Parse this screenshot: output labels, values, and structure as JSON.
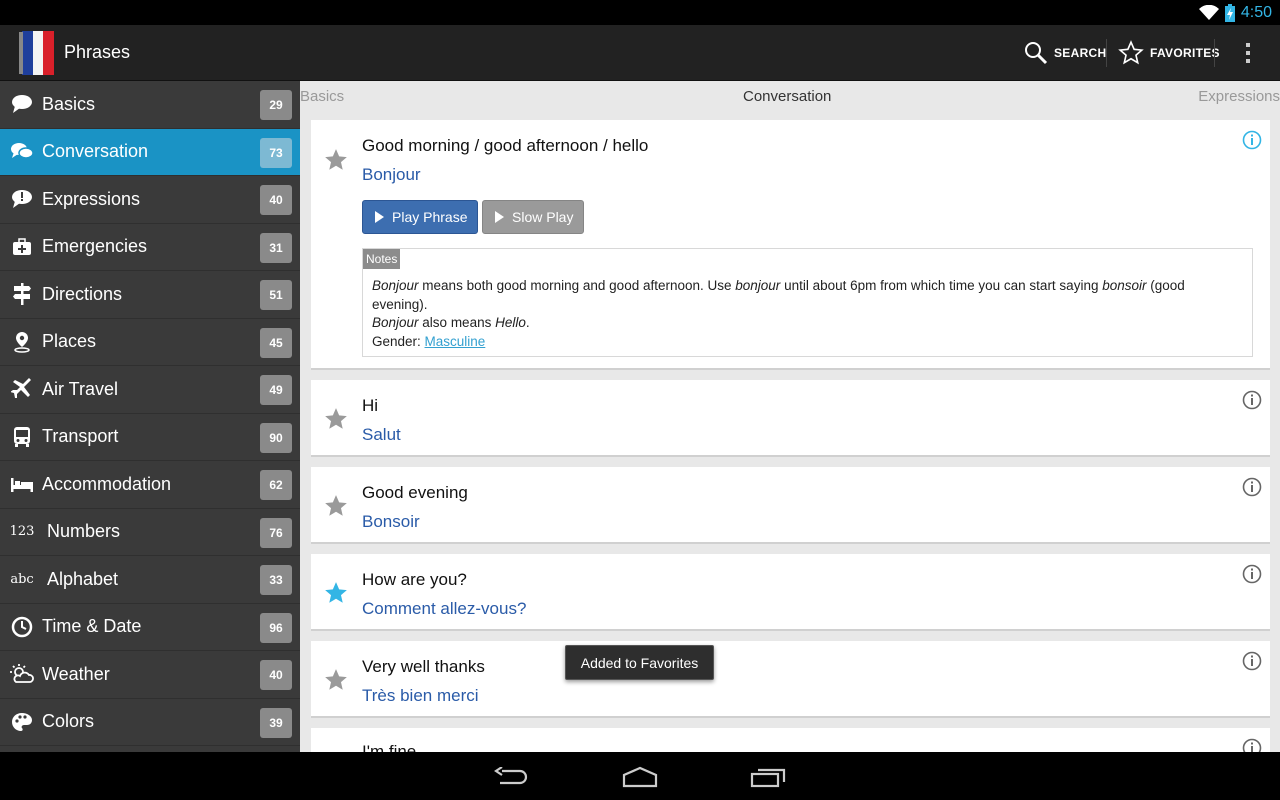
{
  "status_bar": {
    "time": "4:50"
  },
  "action_bar": {
    "title": "Phrases",
    "search_label": "SEARCH",
    "favorites_label": "FAVORITES"
  },
  "sidebar": {
    "items": [
      {
        "label": "Basics",
        "count": "29",
        "icon": "speech-bubble-icon"
      },
      {
        "label": "Conversation",
        "count": "73",
        "icon": "conversation-bubbles-icon",
        "active": true
      },
      {
        "label": "Expressions",
        "count": "40",
        "icon": "exclamation-bubble-icon"
      },
      {
        "label": "Emergencies",
        "count": "31",
        "icon": "first-aid-kit-icon"
      },
      {
        "label": "Directions",
        "count": "51",
        "icon": "signpost-icon"
      },
      {
        "label": "Places",
        "count": "45",
        "icon": "map-pin-icon"
      },
      {
        "label": "Air Travel",
        "count": "49",
        "icon": "airplane-icon"
      },
      {
        "label": "Transport",
        "count": "90",
        "icon": "bus-icon"
      },
      {
        "label": "Accommodation",
        "count": "62",
        "icon": "bed-icon"
      },
      {
        "label": "Numbers",
        "count": "76",
        "icon": "numbers-icon",
        "icon_text": "123"
      },
      {
        "label": "Alphabet",
        "count": "33",
        "icon": "alphabet-icon",
        "icon_text": "abc"
      },
      {
        "label": "Time & Date",
        "count": "96",
        "icon": "clock-icon"
      },
      {
        "label": "Weather",
        "count": "40",
        "icon": "weather-icon"
      },
      {
        "label": "Colors",
        "count": "39",
        "icon": "palette-icon"
      }
    ]
  },
  "tabs": {
    "left": "Basics",
    "center": "Conversation",
    "right": "Expressions"
  },
  "phrases": [
    {
      "english": "Good morning / good afternoon / hello",
      "french": "Bonjour",
      "favorite": false,
      "play_label": "Play Phrase",
      "slow_label": "Slow Play",
      "notes_tag": "Notes",
      "notes": {
        "w1": "Bonjour",
        "t1": " means both good morning and good afternoon. Use ",
        "w2": "bonjour",
        "t2": " until about 6pm from which time you can start saying ",
        "w3": "bonsoir",
        "t3": " (good evening).",
        "w4": "Bonjour",
        "t4": " also means ",
        "w5": "Hello",
        "t5": ".",
        "gender_label": "Gender: ",
        "gender_value": "Masculine"
      }
    },
    {
      "english": "Hi",
      "french": "Salut",
      "favorite": false
    },
    {
      "english": "Good evening",
      "french": "Bonsoir",
      "favorite": false
    },
    {
      "english": "How are you?",
      "french": "Comment allez-vous?",
      "favorite": true
    },
    {
      "english": "Very well thanks",
      "french": "Très bien merci",
      "favorite": false
    },
    {
      "english": "I'm fine"
    }
  ],
  "toast": "Added to Favorites",
  "colors": {
    "accent": "#33b5e5",
    "active_item": "#1a93c5",
    "french_text": "#2a5ba8",
    "play_button": "#3d6eb0",
    "star_favorite": "#33b5e5",
    "star_default": "#999999"
  }
}
